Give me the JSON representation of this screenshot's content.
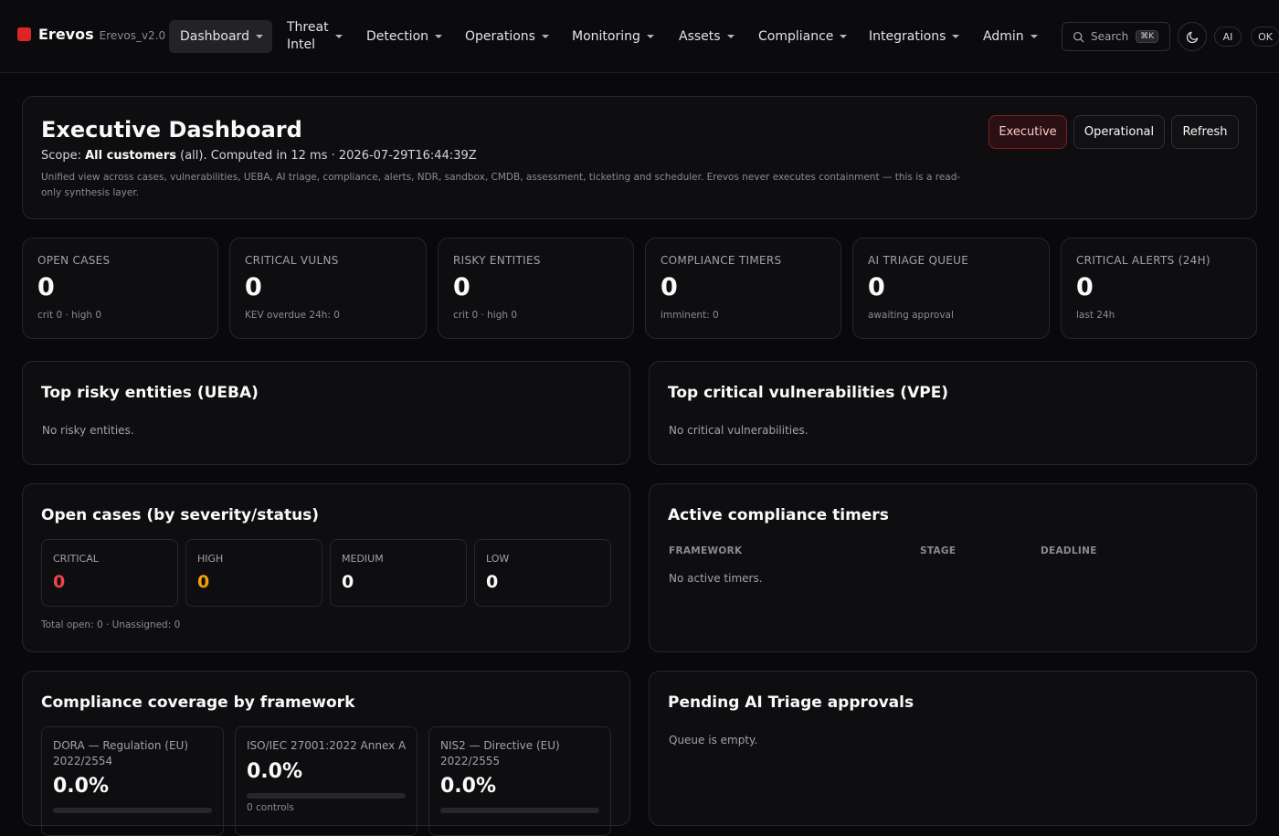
{
  "brand": {
    "name": "Erevos",
    "version": "Erevos_v2.0"
  },
  "nav": {
    "dashboard": "Dashboard",
    "threat_line1": "Threat",
    "threat_line2": "Intel",
    "detection": "Detection",
    "operations": "Operations",
    "monitoring": "Monitoring",
    "assets": "Assets",
    "compliance": "Compliance",
    "integrations": "Integrations",
    "admin": "Admin"
  },
  "topbar": {
    "search_label": "Search",
    "search_shortcut": "⌘K",
    "theme_icon": "moon-icon",
    "ai_label": "AI",
    "ok_label": "OK"
  },
  "header": {
    "title": "Executive Dashboard",
    "scope_prefix": "Scope:",
    "scope_value": "All customers",
    "scope_suffix": "(all). Computed in 12 ms · 2026-07-29T16:44:39Z",
    "description": "Unified view across cases, vulnerabilities, UEBA, AI triage, compliance, alerts, NDR, sandbox, CMDB, assessment, ticketing and scheduler. Erevos never executes containment — this is a read-only synthesis layer.",
    "btn_executive": "Executive",
    "btn_operational": "Operational",
    "btn_refresh": "Refresh"
  },
  "kpis": [
    {
      "label": "OPEN CASES",
      "value": "0",
      "sub": "crit 0 · high 0"
    },
    {
      "label": "CRITICAL VULNS",
      "value": "0",
      "sub": "KEV overdue 24h: 0"
    },
    {
      "label": "RISKY ENTITIES",
      "value": "0",
      "sub": "crit 0 · high 0"
    },
    {
      "label": "COMPLIANCE TIMERS",
      "value": "0",
      "sub": "imminent: 0"
    },
    {
      "label": "AI TRIAGE QUEUE",
      "value": "0",
      "sub": "awaiting approval"
    },
    {
      "label": "CRITICAL ALERTS (24H)",
      "value": "0",
      "sub": "last 24h"
    }
  ],
  "risky": {
    "title": "Top risky entities (UEBA)",
    "empty": "No risky entities."
  },
  "vulns": {
    "title": "Top critical vulnerabilities (VPE)",
    "empty": "No critical vulnerabilities."
  },
  "cases": {
    "title": "Open cases (by severity/status)",
    "severities": [
      {
        "label": "CRITICAL",
        "value": "0",
        "color": "#ef4444"
      },
      {
        "label": "HIGH",
        "value": "0",
        "color": "#f59e0b"
      },
      {
        "label": "MEDIUM",
        "value": "0",
        "color": "#fafafa"
      },
      {
        "label": "LOW",
        "value": "0",
        "color": "#fafafa"
      }
    ],
    "footer": "Total open: 0 · Unassigned: 0"
  },
  "timers": {
    "title": "Active compliance timers",
    "col_framework": "FRAMEWORK",
    "col_stage": "STAGE",
    "col_deadline": "DEADLINE",
    "empty": "No active timers."
  },
  "coverage": {
    "title": "Compliance coverage by framework",
    "frameworks": [
      {
        "name_line1": "DORA — Regulation (EU)",
        "name_line2": "2022/2554",
        "pct": "0.0%",
        "coverage": 0
      },
      {
        "name_line1": "ISO/IEC 27001:2022 Annex A",
        "name_line2": "",
        "pct": "0.0%",
        "coverage": 0,
        "sub": "0 controls"
      },
      {
        "name_line1": "NIS2 — Directive (EU)",
        "name_line2": "2022/2555",
        "pct": "0.0%",
        "coverage": 0
      }
    ]
  },
  "triage": {
    "title": "Pending AI Triage approvals",
    "empty": "Queue is empty."
  }
}
